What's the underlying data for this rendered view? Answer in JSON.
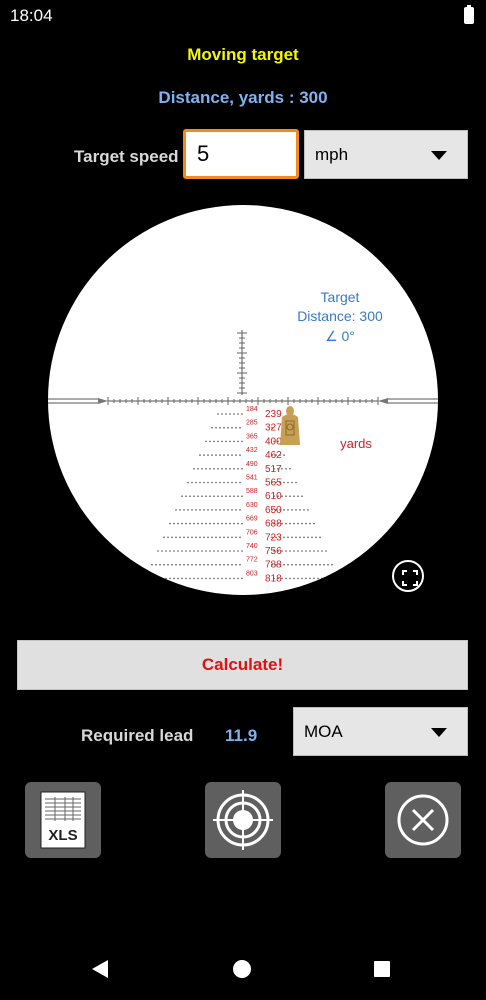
{
  "status": {
    "time": "18:04"
  },
  "title": "Moving target",
  "distance_text": "Distance, yards : 300",
  "speed": {
    "label": "Target speed",
    "value": "5",
    "unit": "mph"
  },
  "scope": {
    "info_line1": "Target",
    "info_line2": "Distance: 300",
    "info_line3": "∠ 0°",
    "unit_label": "yards",
    "range_labels": [
      "239",
      "327",
      "400",
      "462",
      "517",
      "565",
      "610",
      "650",
      "688",
      "723",
      "756",
      "788",
      "818"
    ],
    "small_labels": [
      "184",
      "285",
      "365",
      "432",
      "490",
      "541",
      "588",
      "630",
      "669",
      "706",
      "740",
      "772",
      "803"
    ]
  },
  "calculate_label": "Calculate!",
  "lead": {
    "label": "Required lead",
    "value": "11.9",
    "unit": "MOA"
  },
  "tools": {
    "xls_label": "XLS"
  },
  "icons": {
    "xls": "xls-file-icon",
    "target": "target-icon",
    "close": "close-circle-icon",
    "fullscreen": "fullscreen-icon",
    "nav_back": "back-icon",
    "nav_home": "home-icon",
    "nav_recent": "recent-apps-icon"
  },
  "colors": {
    "title": "#f5f500",
    "accent_blue": "#7fb3f0",
    "input_border": "#f08b1c",
    "calculate_text": "#e01010",
    "reticle_red": "#d42020"
  }
}
